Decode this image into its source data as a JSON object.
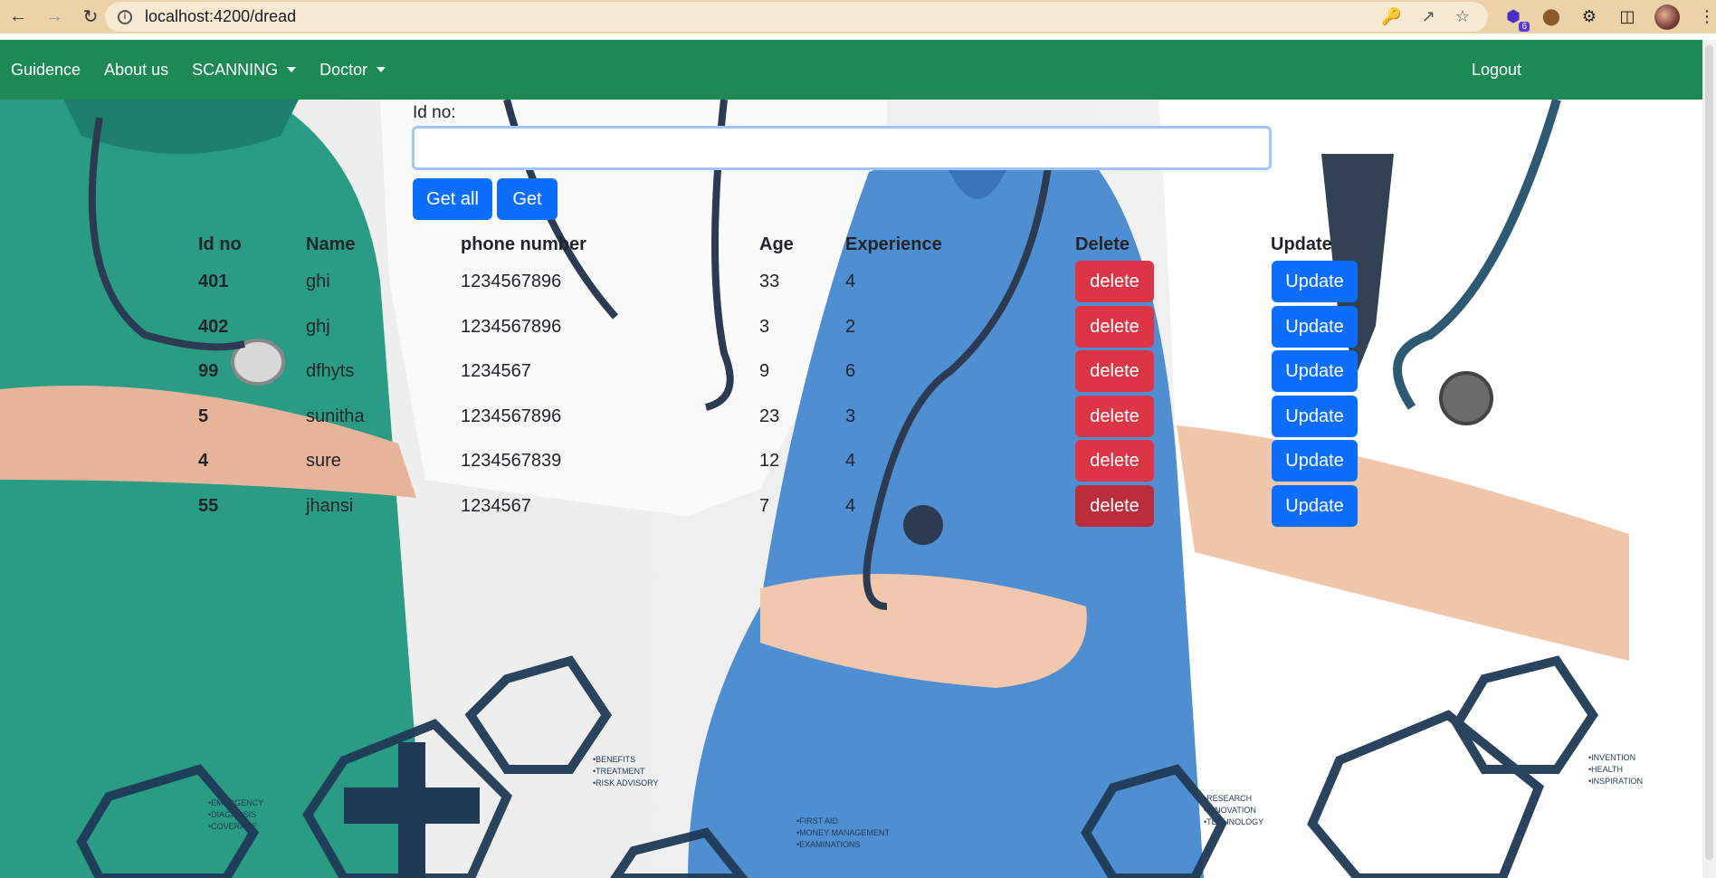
{
  "browser": {
    "url": "localhost:4200/dread",
    "extension_badge": "6"
  },
  "navbar": {
    "items": [
      {
        "label": "Guidence",
        "dropdown": false
      },
      {
        "label": "About us",
        "dropdown": false
      },
      {
        "label": "SCANNING",
        "dropdown": true
      },
      {
        "label": "Doctor",
        "dropdown": true
      }
    ],
    "logout": "Logout",
    "color": "#1d8a55"
  },
  "form": {
    "id_label": "Id no:",
    "id_value": "",
    "get_all_label": "Get all",
    "get_label": "Get"
  },
  "table": {
    "headers": [
      "Id no",
      "Name",
      "phone number",
      "Age",
      "Experience",
      "Delete",
      "Update"
    ],
    "rows": [
      {
        "id": "401",
        "name": "ghi",
        "phone": "1234567896",
        "age": "33",
        "experience": "4"
      },
      {
        "id": "402",
        "name": "ghj",
        "phone": "1234567896",
        "age": "3",
        "experience": "2"
      },
      {
        "id": "99",
        "name": "dfhyts",
        "phone": "1234567",
        "age": "9",
        "experience": "6"
      },
      {
        "id": "5",
        "name": "sunitha",
        "phone": "1234567896",
        "age": "23",
        "experience": "3"
      },
      {
        "id": "4",
        "name": "sure",
        "phone": "1234567839",
        "age": "12",
        "experience": "4"
      },
      {
        "id": "55",
        "name": "jhansi",
        "phone": "1234567",
        "age": "7",
        "experience": "4"
      }
    ],
    "delete_label": "delete",
    "update_label": "Update"
  },
  "hero_texts": [
    "•BENEFITS\n•TREATMENT\n•RISK ADVISORY",
    "•FIRST AID\n•MONEY MANAGEMENT\n•EXAMINATIONS",
    "•RESEARCH\n•INNOVATION\n•TECHNOLOGY",
    "•INVENTION\n•HEALTH\n•INSPIRATION",
    "•EMERGENCY\n•DIAGNOSIS\n•COVERAGE"
  ]
}
